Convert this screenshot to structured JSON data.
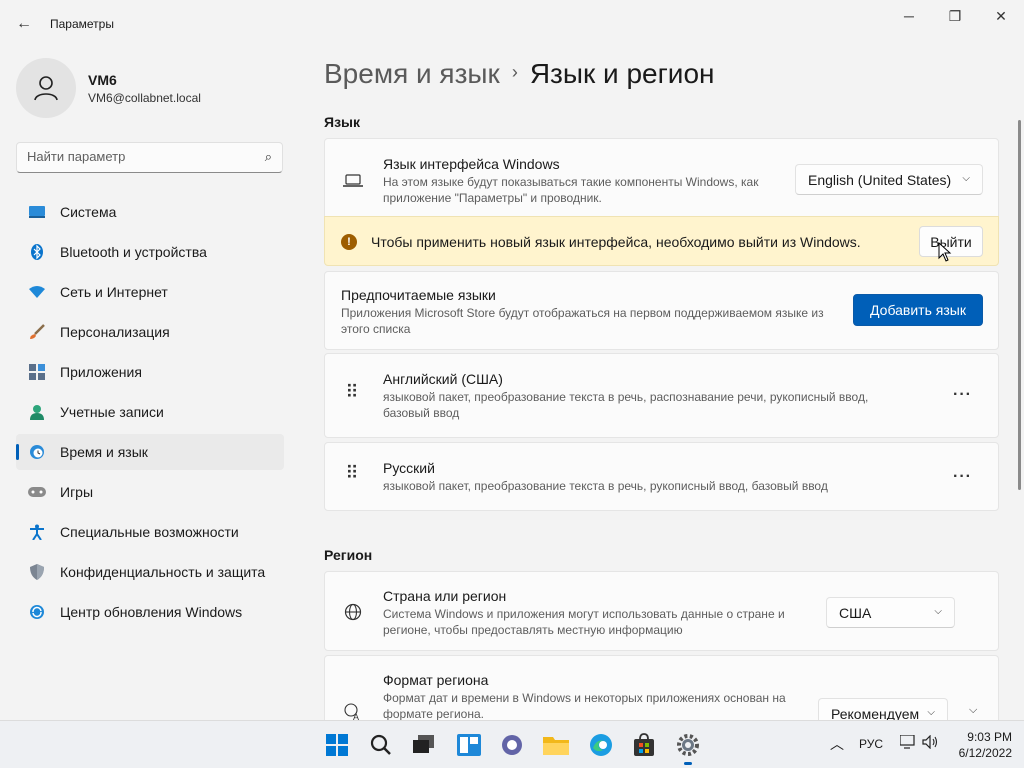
{
  "window": {
    "title": "Параметры"
  },
  "profile": {
    "name": "VM6",
    "email": "VM6@collabnet.local"
  },
  "search": {
    "placeholder": "Найти параметр"
  },
  "sidebar": {
    "items": [
      {
        "label": "Система",
        "icon": "system-icon",
        "color": "#0078d4"
      },
      {
        "label": "Bluetooth и устройства",
        "icon": "bluetooth-icon",
        "color": "#0078d4"
      },
      {
        "label": "Сеть и Интернет",
        "icon": "network-icon",
        "color": "#0078d4"
      },
      {
        "label": "Персонализация",
        "icon": "brush-icon",
        "color": "#e07030"
      },
      {
        "label": "Приложения",
        "icon": "apps-icon",
        "color": "#5a6f8a"
      },
      {
        "label": "Учетные записи",
        "icon": "accounts-icon",
        "color": "#2da57b"
      },
      {
        "label": "Время и язык",
        "icon": "time-language-icon",
        "color": "#0078d4"
      },
      {
        "label": "Игры",
        "icon": "gaming-icon",
        "color": "#7a7a7a"
      },
      {
        "label": "Специальные возможности",
        "icon": "accessibility-icon",
        "color": "#0078d4"
      },
      {
        "label": "Конфиденциальность и защита",
        "icon": "shield-icon",
        "color": "#7a7a7a"
      },
      {
        "label": "Центр обновления Windows",
        "icon": "windows-update-icon",
        "color": "#0078d4"
      }
    ],
    "active_index": 6
  },
  "breadcrumb": {
    "parent": "Время и язык",
    "separator": "›",
    "current": "Язык и регион"
  },
  "language_section": {
    "heading": "Язык",
    "display_language": {
      "title": "Язык интерфейса Windows",
      "description": "На этом языке будут показываться такие компоненты Windows, как приложение \"Параметры\" и проводник.",
      "value": "English (United States)"
    },
    "warning": {
      "text": "Чтобы применить новый язык интерфейса, необходимо выйти из Windows.",
      "button": "Выйти"
    },
    "preferred": {
      "title": "Предпочитаемые языки",
      "description": "Приложения Microsoft Store будут отображаться на первом поддерживаемом языке из этого списка",
      "add_button": "Добавить язык"
    },
    "languages": [
      {
        "name": "Английский (США)",
        "features": "языковой пакет, преобразование текста в речь, распознавание речи, рукописный ввод, базовый ввод"
      },
      {
        "name": "Русский",
        "features": "языковой пакет, преобразование текста в речь, рукописный ввод, базовый ввод"
      }
    ]
  },
  "region_section": {
    "heading": "Регион",
    "country": {
      "title": "Страна или регион",
      "description": "Система Windows и приложения могут использовать данные о стране и регионе, чтобы предоставлять местную информацию",
      "value": "США"
    },
    "format": {
      "title": "Формат региона",
      "description": "Формат дат и времени в Windows и некоторых приложениях основан на формате региона.",
      "value": "Рекомендуем"
    }
  },
  "taskbar": {
    "apps": [
      "windows-start-icon",
      "search-icon",
      "task-view-icon",
      "widgets-icon",
      "teams-chat-icon",
      "file-explorer-icon",
      "edge-icon",
      "store-icon",
      "settings-icon"
    ],
    "active_app": "settings-icon",
    "language": "РУС",
    "time": "9:03 PM",
    "date": "6/12/2022"
  }
}
